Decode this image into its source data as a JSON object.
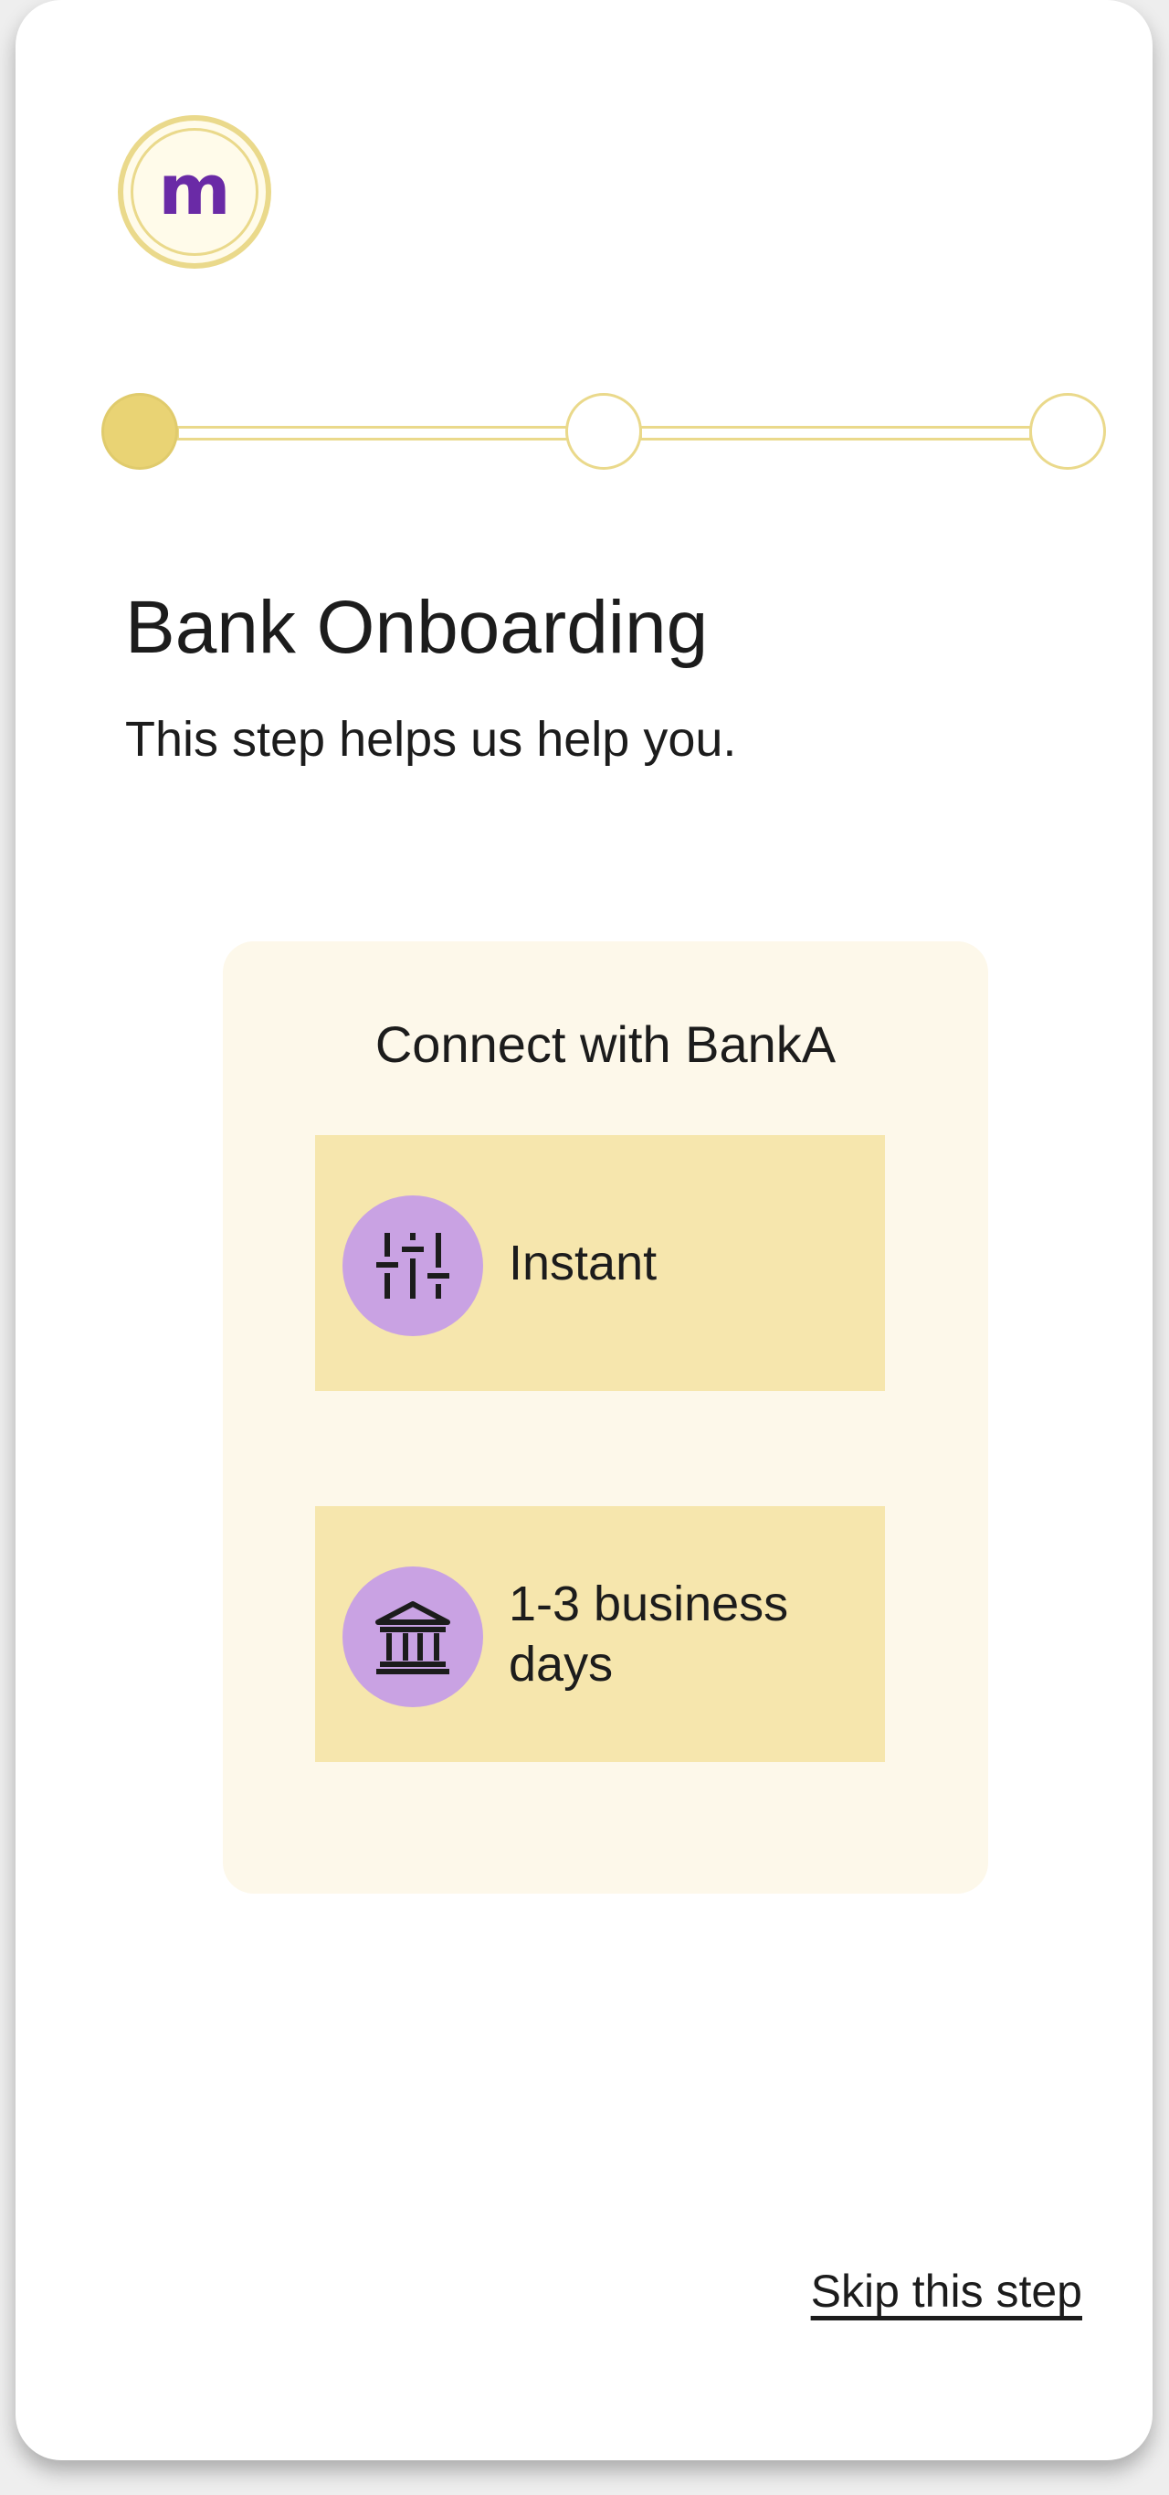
{
  "logo": {
    "letter": "m"
  },
  "stepper": {
    "current_step": 1,
    "total_steps": 3
  },
  "header": {
    "title": "Bank Onboarding",
    "subtitle": "This step helps us help you."
  },
  "card": {
    "title": "Connect with BankA",
    "options": [
      {
        "label": "Instant",
        "icon": "sliders-icon"
      },
      {
        "label": "1-3 business days",
        "icon": "bank-icon"
      }
    ]
  },
  "footer": {
    "skip_label": "Skip this step"
  },
  "colors": {
    "accent_gold": "#ead98b",
    "step_active": "#e9d374",
    "card_background": "#fdf8ea",
    "option_background": "#f6e6ad",
    "icon_circle": "#c9a2e3",
    "logo_letter": "#6a2aa6"
  }
}
